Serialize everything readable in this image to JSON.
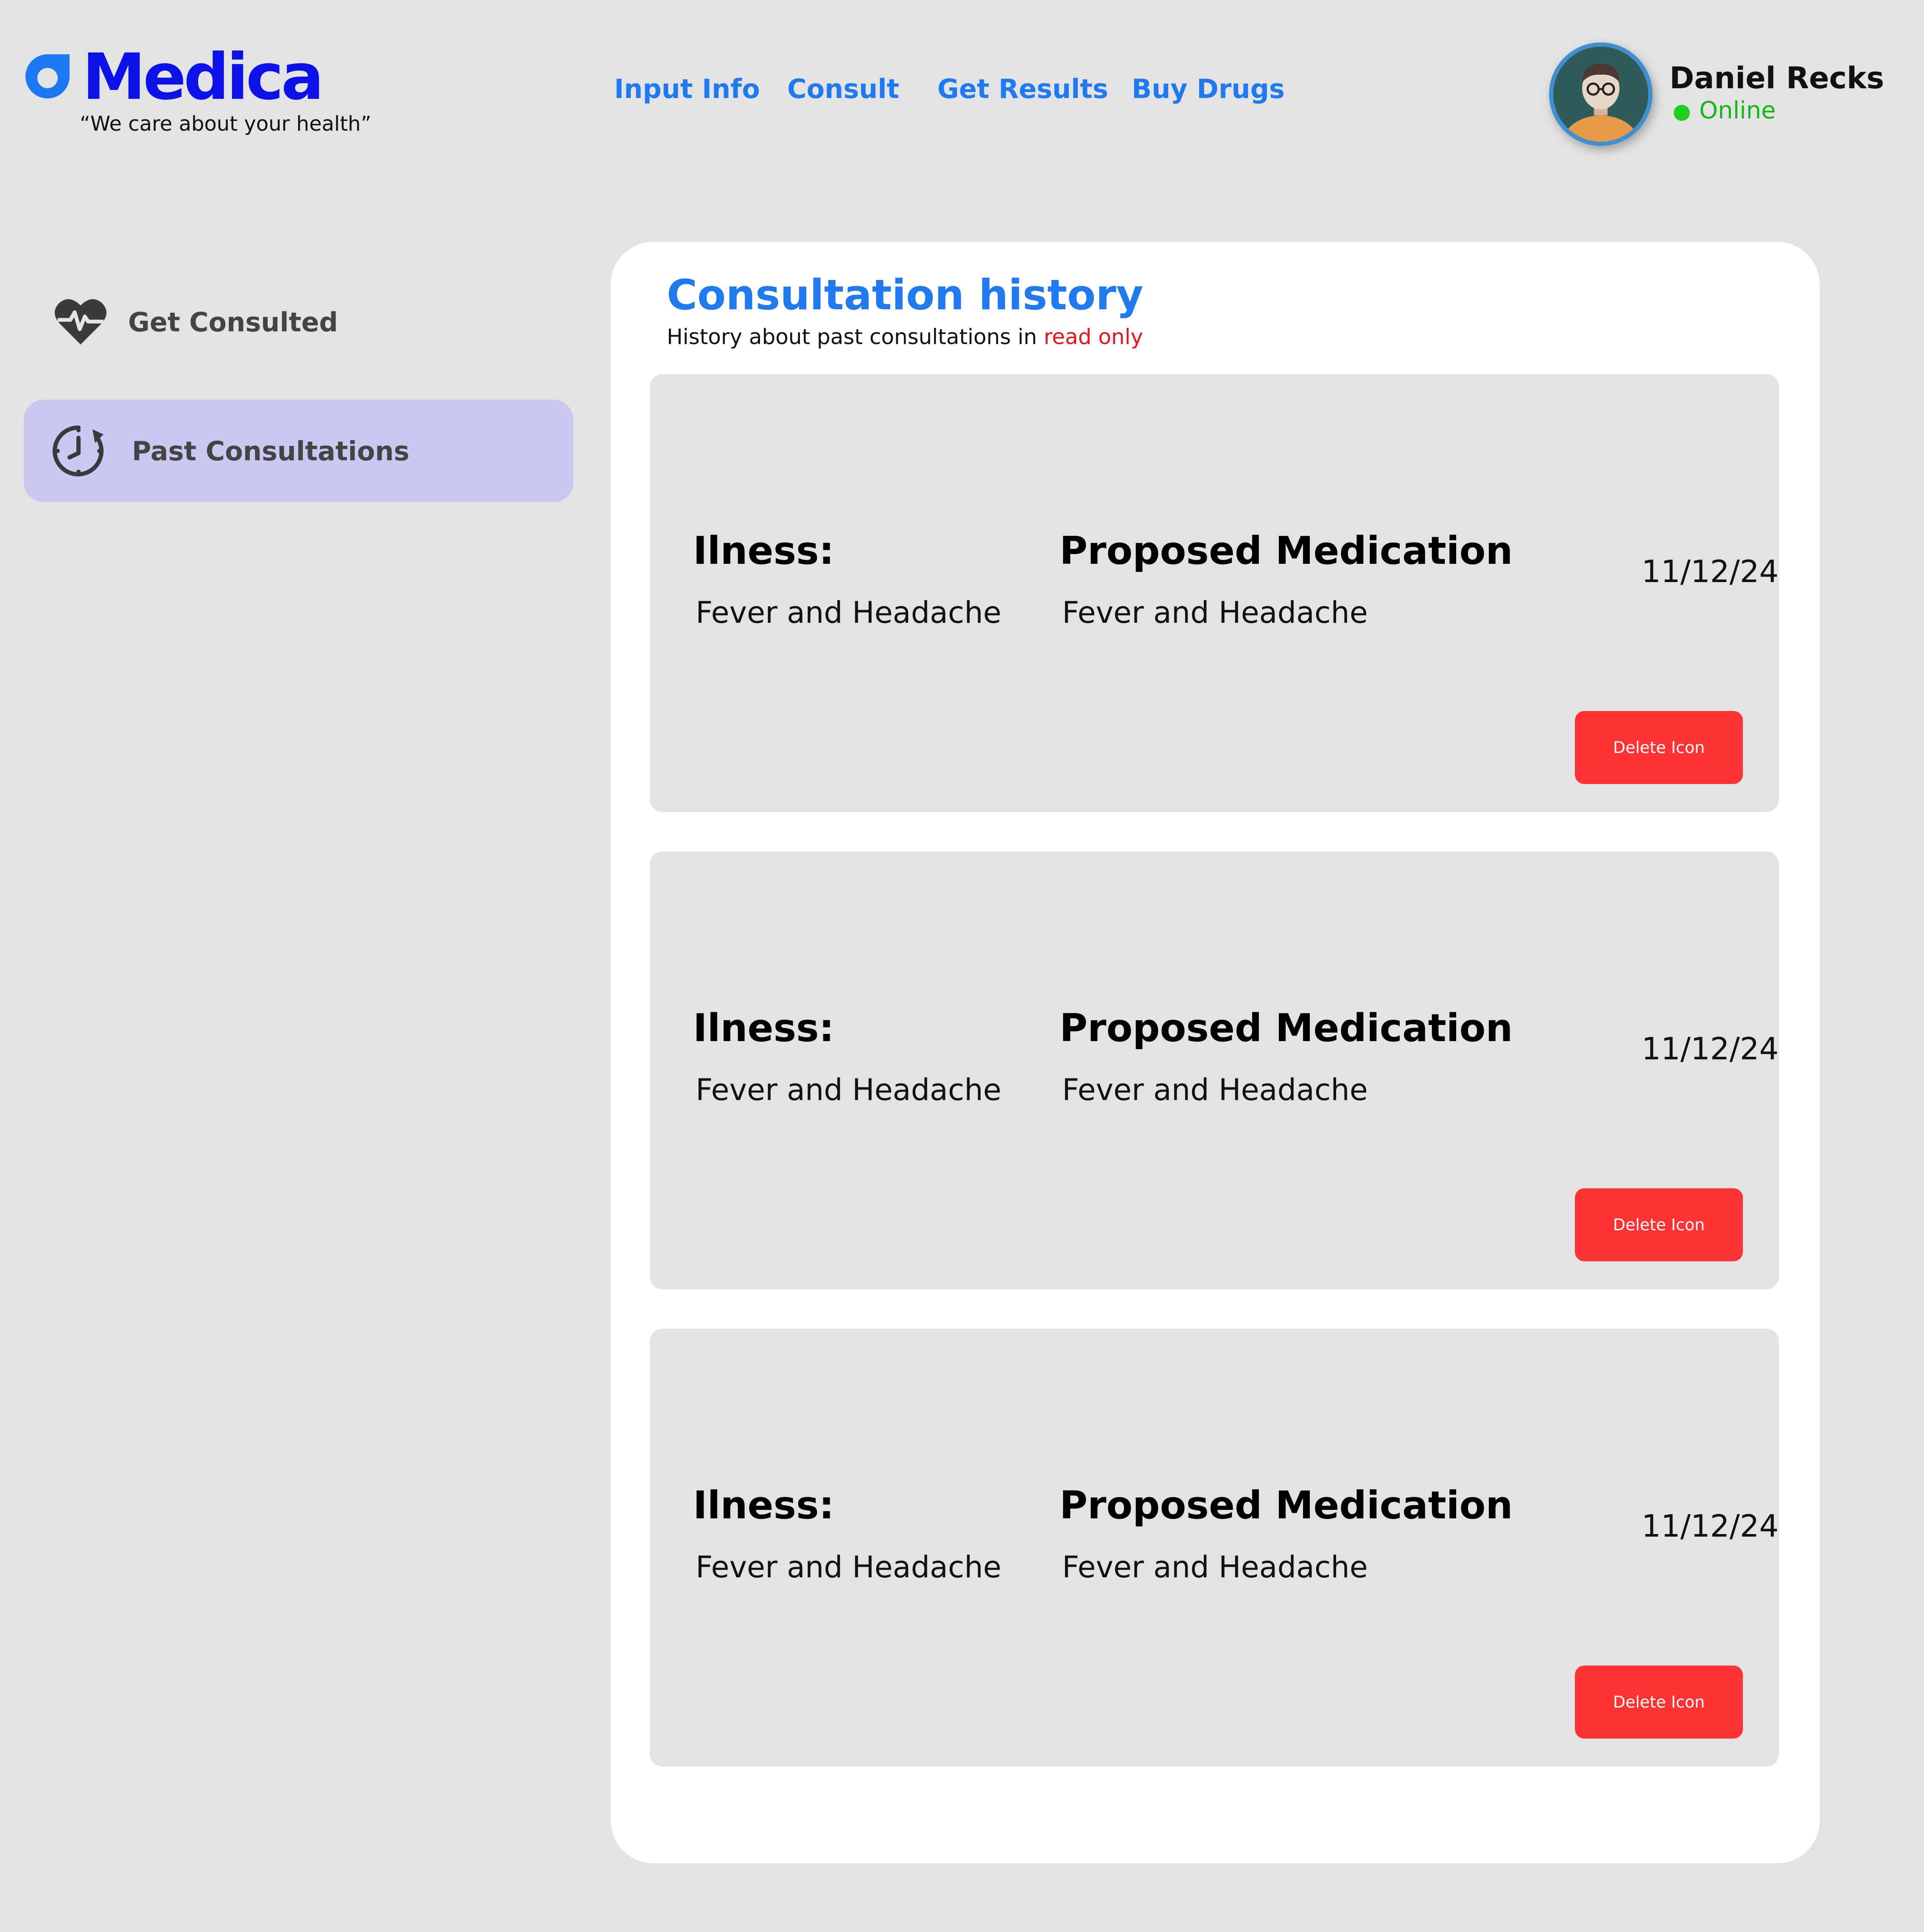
{
  "brand": {
    "name": "Medica",
    "tagline": "“We care about your health”",
    "color": "#0a12e8"
  },
  "nav": {
    "items": [
      {
        "label": "Input Info"
      },
      {
        "label": "Consult"
      },
      {
        "label": "Get Results"
      },
      {
        "label": "Buy Drugs"
      }
    ]
  },
  "user": {
    "name": "Daniel Recks",
    "status": "Online",
    "status_color": "#1fd01f",
    "avatar_icon": "avatar-icon"
  },
  "sidebar": {
    "items": [
      {
        "label": "Get Consulted",
        "icon": "heart-pulse-icon",
        "active": false
      },
      {
        "label": "Past Consultations",
        "icon": "clock-history-icon",
        "active": true
      }
    ],
    "active_color": "#c8c8f2"
  },
  "main": {
    "title": "Consultation history",
    "subtitle_prefix": "History about past consultations in ",
    "subtitle_highlight": "read only",
    "cards": [
      {
        "illness_label": "Ilness:",
        "illness_value": "Fever and Headache",
        "medication_label": "Proposed Medication",
        "medication_value": "Fever and Headache",
        "date": "11/12/24",
        "delete_label": "Delete Icon"
      },
      {
        "illness_label": "Ilness:",
        "illness_value": "Fever and Headache",
        "medication_label": "Proposed Medication",
        "medication_value": "Fever and Headache",
        "date": "11/12/24",
        "delete_label": "Delete Icon"
      },
      {
        "illness_label": "Ilness:",
        "illness_value": "Fever and Headache",
        "medication_label": "Proposed Medication",
        "medication_value": "Fever and Headache",
        "date": "11/12/24",
        "delete_label": "Delete Icon"
      }
    ]
  },
  "colors": {
    "accent": "#1f79ef",
    "danger": "#fe3333",
    "background": "#e3e3e3"
  }
}
